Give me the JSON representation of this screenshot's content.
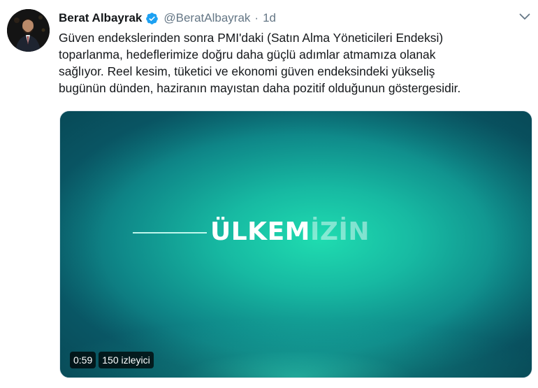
{
  "tweet": {
    "author_name": "Berat Albayrak",
    "handle": "@BeratAlbayrak",
    "separator": "·",
    "time": "1d",
    "text_lines": [
      "Güven endekslerinden sonra PMI'daki (Satın Alma Yöneticileri Endeksi)",
      "toparlanma, hedeflerimize doğru daha güçlü adımlar atmamıza olanak",
      "sağlıyor. Reel kesim, tüketici ve ekonomi güven endeksindeki yükseliş",
      "bugünün dünden, haziranın mayıstan daha pozitif olduğunun göstergesidir."
    ],
    "verified_icon": "verified-badge-icon",
    "caret_icon": "chevron-down-icon"
  },
  "video": {
    "title_main": "ÜLKEM",
    "title_faded": "İZİN",
    "duration": "0:59",
    "views": "150 izleyici"
  },
  "colors": {
    "verified_blue": "#1da1f2",
    "secondary_text": "#657786",
    "video_teal": "#17b9a2"
  }
}
